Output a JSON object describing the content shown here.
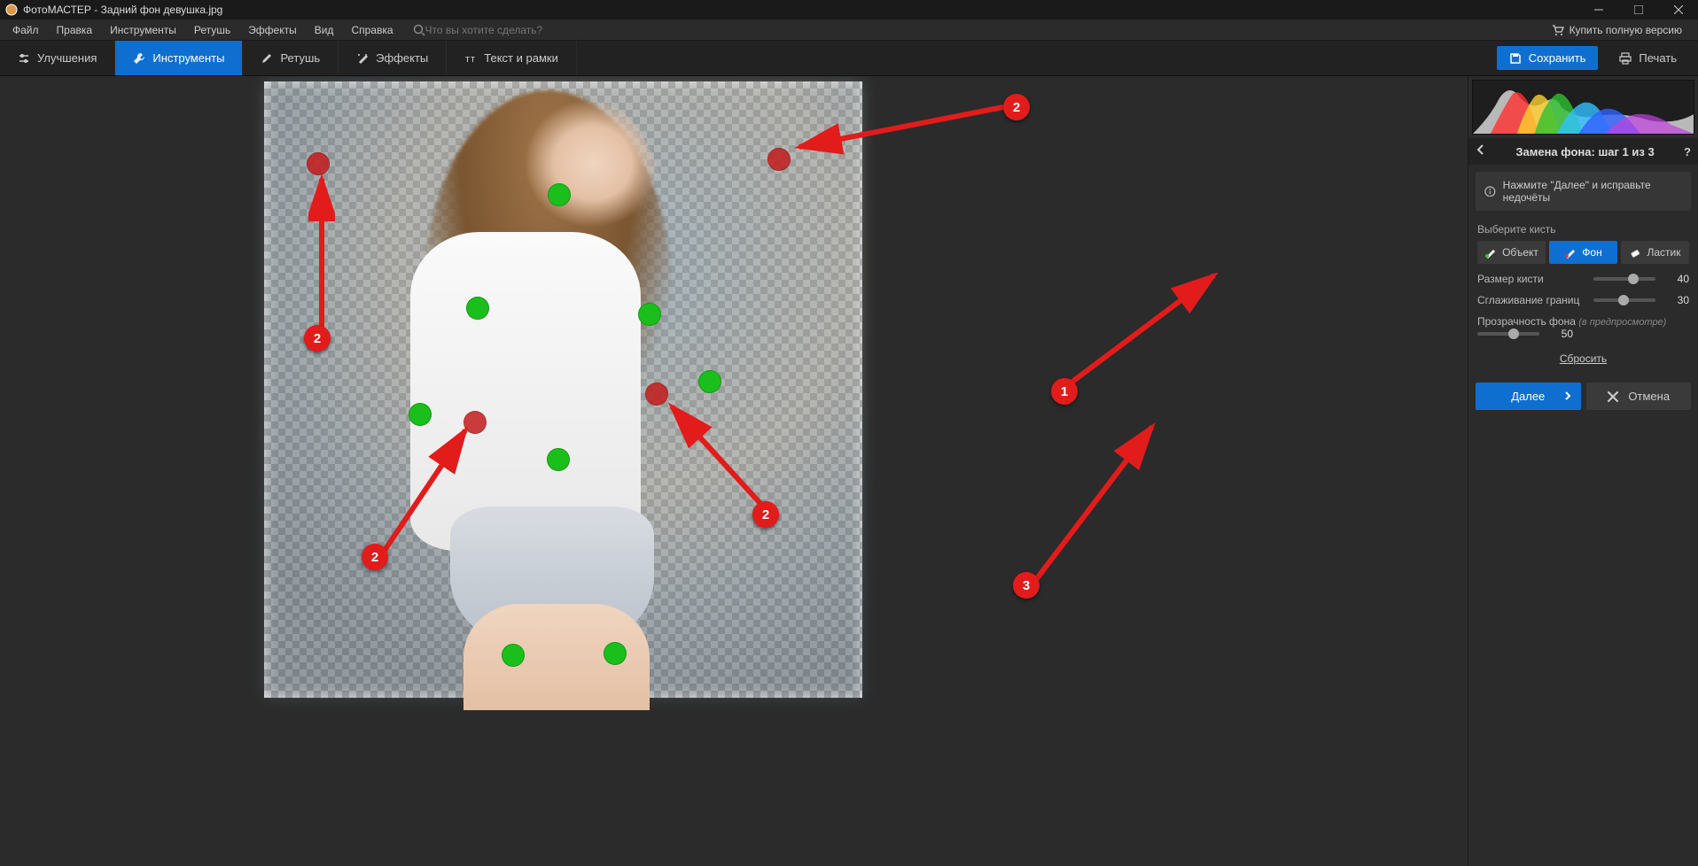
{
  "titlebar": {
    "app": "ФотоМАСТЕР",
    "file": "Задний фон девушка.jpg"
  },
  "menu": {
    "items": [
      "Файл",
      "Правка",
      "Инструменты",
      "Ретушь",
      "Эффекты",
      "Вид",
      "Справка"
    ],
    "search_placeholder": "Что вы хотите сделать?",
    "buy_full": "Купить полную версию"
  },
  "toolbar": {
    "tabs": [
      {
        "label": "Улучшения"
      },
      {
        "label": "Инструменты"
      },
      {
        "label": "Ретушь"
      },
      {
        "label": "Эффекты"
      },
      {
        "label": "Текст и рамки"
      }
    ],
    "save": "Сохранить",
    "print": "Печать"
  },
  "panel": {
    "title": "Замена фона: шаг 1 из 3",
    "hint": "Нажмите \"Далее\" и исправьте недочёты",
    "choose_brush": "Выберите кисть",
    "brushes": {
      "object": "Объект",
      "background": "Фон",
      "eraser": "Ластик"
    },
    "sliders": {
      "size_label": "Размер кисти",
      "size_value": "40",
      "smooth_label": "Сглаживание границ",
      "smooth_value": "30",
      "opacity_label": "Прозрачность фона",
      "opacity_hint": "(в предпросмотре)",
      "opacity_value": "50"
    },
    "reset": "Сбросить",
    "next": "Далее",
    "cancel": "Отмена"
  },
  "callouts": {
    "c1": "1",
    "c2": "2",
    "c3": "3"
  }
}
